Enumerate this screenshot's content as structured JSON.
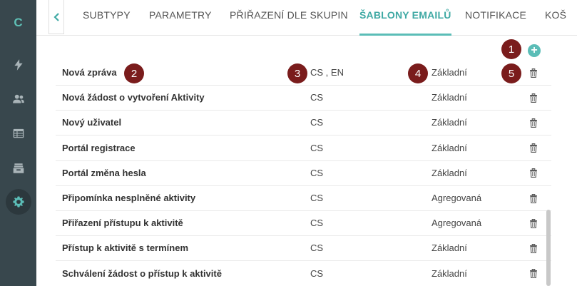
{
  "app": {
    "logo": "C"
  },
  "sidebar": {
    "items": [
      {
        "icon": "lightning-icon"
      },
      {
        "icon": "users-icon"
      },
      {
        "icon": "table-icon"
      },
      {
        "icon": "archive-icon"
      },
      {
        "icon": "gear-icon",
        "active": true
      }
    ]
  },
  "tabs": [
    {
      "label": "SUBTYPY"
    },
    {
      "label": "PARAMETRY"
    },
    {
      "label": "PŘIŘAZENÍ DLE SKUPIN"
    },
    {
      "label": "ŠABLONY EMAILŮ",
      "active": true
    },
    {
      "label": "NOTIFIKACE"
    },
    {
      "label": "KOŠ"
    }
  ],
  "markers": [
    "1",
    "2",
    "3",
    "4",
    "5"
  ],
  "templates": [
    {
      "name": "Nová zpráva",
      "languages": "CS , EN",
      "type": "Základní"
    },
    {
      "name": "Nová žádost o vytvoření Aktivity",
      "languages": "CS",
      "type": "Základní"
    },
    {
      "name": "Nový uživatel",
      "languages": "CS",
      "type": "Základní"
    },
    {
      "name": "Portál registrace",
      "languages": "CS",
      "type": "Základní"
    },
    {
      "name": "Portál změna hesla",
      "languages": "CS",
      "type": "Základní"
    },
    {
      "name": "Připomínka nesplněné aktivity",
      "languages": "CS",
      "type": "Agregovaná"
    },
    {
      "name": "Přiřazení přístupu k aktivitě",
      "languages": "CS",
      "type": "Agregovaná"
    },
    {
      "name": "Přístup k aktivitě s termínem",
      "languages": "CS",
      "type": "Základní"
    },
    {
      "name": "Schválení žádost o přístup k aktivitě",
      "languages": "CS",
      "type": "Základní"
    }
  ],
  "colors": {
    "accent": "#5bbdb7",
    "sidebar": "#38474d",
    "marker": "#7a1c1c"
  }
}
